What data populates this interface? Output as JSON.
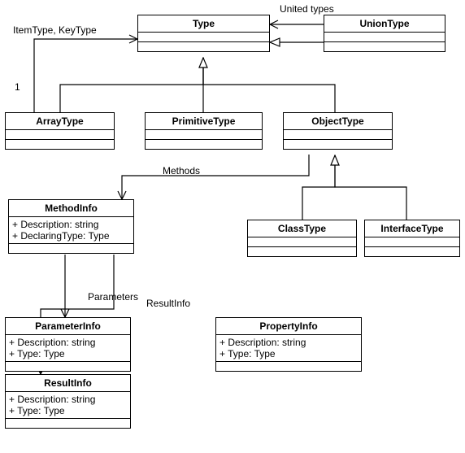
{
  "classes": {
    "type": {
      "name": "Type",
      "attrs": []
    },
    "unionType": {
      "name": "UnionType",
      "attrs": []
    },
    "arrayType": {
      "name": "ArrayType",
      "attrs": []
    },
    "primitiveType": {
      "name": "PrimitiveType",
      "attrs": []
    },
    "objectType": {
      "name": "ObjectType",
      "attrs": []
    },
    "classType": {
      "name": "ClassType",
      "attrs": []
    },
    "interfaceType": {
      "name": "InterfaceType",
      "attrs": []
    },
    "methodInfo": {
      "name": "MethodInfo",
      "attrs": [
        "+ Description: string",
        "+ DeclaringType: Type"
      ]
    },
    "parameterInfo": {
      "name": "ParameterInfo",
      "attrs": [
        "+ Description: string",
        "+ Type: Type"
      ]
    },
    "propertyInfo": {
      "name": "PropertyInfo",
      "attrs": [
        "+ Description: string",
        "+ Type: Type"
      ]
    },
    "resultInfo": {
      "name": "ResultInfo",
      "attrs": [
        "+ Description: string",
        "+ Type: Type"
      ]
    }
  },
  "labels": {
    "itemKey": "ItemType, KeyType",
    "unitedTypes": "United types",
    "one": "1",
    "methods": "Methods",
    "parameters": "Parameters",
    "resultInfo": "ResultInfo"
  },
  "chart_data": {
    "type": "table",
    "kind": "uml-class-diagram",
    "nodes": [
      {
        "id": "Type",
        "attributes": []
      },
      {
        "id": "UnionType",
        "attributes": []
      },
      {
        "id": "ArrayType",
        "attributes": []
      },
      {
        "id": "PrimitiveType",
        "attributes": []
      },
      {
        "id": "ObjectType",
        "attributes": []
      },
      {
        "id": "ClassType",
        "attributes": []
      },
      {
        "id": "InterfaceType",
        "attributes": []
      },
      {
        "id": "MethodInfo",
        "attributes": [
          "Description: string",
          "DeclaringType: Type"
        ]
      },
      {
        "id": "ParameterInfo",
        "attributes": [
          "Description: string",
          "Type: Type"
        ]
      },
      {
        "id": "PropertyInfo",
        "attributes": [
          "Description: string",
          "Type: Type"
        ]
      },
      {
        "id": "ResultInfo",
        "attributes": [
          "Description: string",
          "Type: Type"
        ]
      }
    ],
    "edges": [
      {
        "from": "ArrayType",
        "to": "Type",
        "type": "generalization"
      },
      {
        "from": "PrimitiveType",
        "to": "Type",
        "type": "generalization"
      },
      {
        "from": "ObjectType",
        "to": "Type",
        "type": "generalization"
      },
      {
        "from": "UnionType",
        "to": "Type",
        "type": "generalization"
      },
      {
        "from": "ClassType",
        "to": "ObjectType",
        "type": "generalization"
      },
      {
        "from": "InterfaceType",
        "to": "ObjectType",
        "type": "generalization"
      },
      {
        "from": "ArrayType",
        "to": "Type",
        "type": "association",
        "label": "ItemType, KeyType",
        "multiplicity": "1"
      },
      {
        "from": "UnionType",
        "to": "Type",
        "type": "association",
        "label": "United types"
      },
      {
        "from": "ObjectType",
        "to": "MethodInfo",
        "type": "association",
        "label": "Methods"
      },
      {
        "from": "MethodInfo",
        "to": "ParameterInfo",
        "type": "association",
        "label": "Parameters"
      },
      {
        "from": "MethodInfo",
        "to": "ResultInfo",
        "type": "association",
        "label": "ResultInfo"
      }
    ]
  }
}
